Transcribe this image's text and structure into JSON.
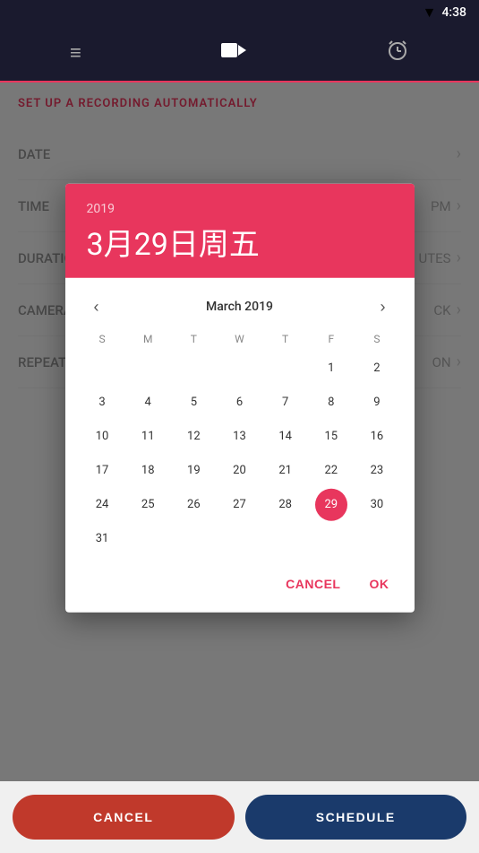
{
  "statusBar": {
    "time": "4:38",
    "wifiIcon": "wifi",
    "batteryIcon": "battery"
  },
  "topNav": {
    "menuIcon": "≡",
    "videoIcon": "▶",
    "alarmIcon": "⏰"
  },
  "mainPage": {
    "setupTitle": "SET UP A RECORDING AUTOMATICALLY",
    "rows": [
      {
        "label": "DATE",
        "value": "",
        "hasChevron": true
      },
      {
        "label": "TIME",
        "value": "PM",
        "hasChevron": true
      },
      {
        "label": "DURATION",
        "value": "UTES",
        "hasChevron": true
      },
      {
        "label": "CAMERA",
        "value": "CK",
        "hasChevron": true
      },
      {
        "label": "REPEAT",
        "value": "ON",
        "hasChevron": true
      }
    ]
  },
  "calendarDialog": {
    "year": "2019",
    "dateTitle": "3月29日周五",
    "monthLabel": "March 2019",
    "weekdays": [
      "S",
      "M",
      "T",
      "W",
      "T",
      "F",
      "S"
    ],
    "weeks": [
      [
        "",
        "",
        "",
        "",
        "",
        "1",
        "2"
      ],
      [
        "3",
        "4",
        "5",
        "6",
        "7",
        "8",
        "9"
      ],
      [
        "10",
        "11",
        "12",
        "13",
        "14",
        "15",
        "16"
      ],
      [
        "17",
        "18",
        "19",
        "20",
        "21",
        "22",
        "23"
      ],
      [
        "24",
        "25",
        "26",
        "27",
        "28",
        "29",
        "30"
      ],
      [
        "31",
        "",
        "",
        "",
        "",
        "",
        ""
      ]
    ],
    "selectedDay": "29",
    "cancelLabel": "CANCEL",
    "okLabel": "OK"
  },
  "bottomBar": {
    "cancelLabel": "CANCEL",
    "scheduleLabel": "SCHEDULE"
  }
}
